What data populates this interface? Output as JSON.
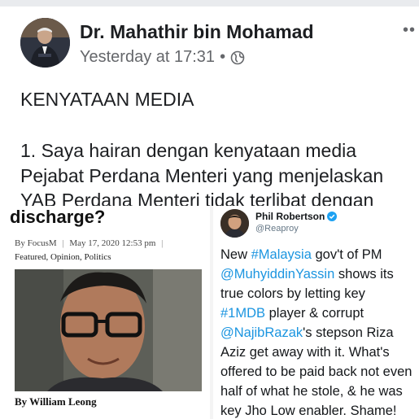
{
  "facebook_post": {
    "author": "Dr. Mahathir bin Mohamad",
    "time": "Yesterday at 17:31",
    "separator": "•",
    "more": "••",
    "heading": "KENYATAAN MEDIA",
    "lines": [
      "1. Saya hairan dengan kenyataan media",
      "Pejabat Perdana Menteri yang menjelaskan",
      "YAB Perdana Menteri tidak terlibat dengan"
    ]
  },
  "article": {
    "title": "discharge?",
    "by": "By FocusM",
    "separator": "|",
    "date": "May 17, 2020 12:53 pm",
    "trailing_separator": "|",
    "categories": "Featured, Opinion, Politics",
    "author_line": "By William Leong"
  },
  "tweet": {
    "name": "Phil Robertson",
    "handle": "@Reaproy",
    "text_lines": [
      [
        {
          "t": "New "
        },
        {
          "t": "#Malaysia",
          "link": true
        },
        {
          "t": " gov't of PM"
        }
      ],
      [
        {
          "t": "@MuhyiddinYassin",
          "link": true
        },
        {
          "t": " shows its"
        }
      ],
      [
        {
          "t": "true colors by letting key"
        }
      ],
      [
        {
          "t": "#1MDB",
          "link": true
        },
        {
          "t": " player & corrupt"
        }
      ],
      [
        {
          "t": "@NajibRazak",
          "link": true
        },
        {
          "t": "'s stepson Riza"
        }
      ],
      [
        {
          "t": "Aziz get away with it. What's"
        }
      ],
      [
        {
          "t": "offered to be paid back not even"
        }
      ],
      [
        {
          "t": "half of what he stole, & he was"
        }
      ],
      [
        {
          "t": "key Jho Low enabler. Shame!"
        }
      ]
    ]
  },
  "colors": {
    "link": "#1b95e0",
    "facebook_text": "#1c1e21",
    "facebook_meta": "#65676b",
    "twitter_verified": "#1da1f2"
  }
}
